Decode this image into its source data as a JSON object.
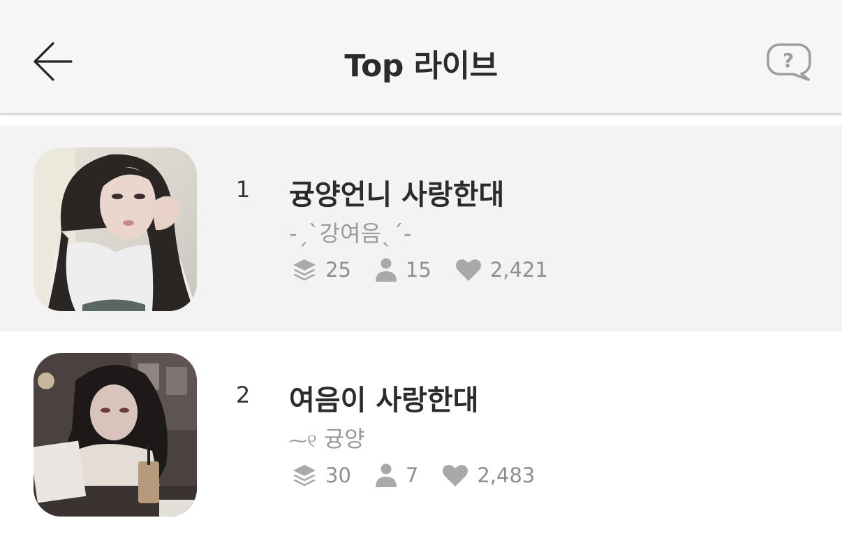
{
  "header": {
    "title": "Top 라이브",
    "back_icon": "arrow-left-icon",
    "help_icon": "question-bubble-icon"
  },
  "lives": [
    {
      "rank": "1",
      "title": "귱양언니 사랑한대",
      "host": "-ˏˋ강여음ˎˊ-",
      "episodes": "25",
      "viewers": "15",
      "likes": "2,421",
      "highlighted": true
    },
    {
      "rank": "2",
      "title": "여음이 사랑한대",
      "host": "귱양",
      "host_flourish": "⁓୧",
      "episodes": "30",
      "viewers": "7",
      "likes": "2,483",
      "highlighted": false
    }
  ],
  "colors": {
    "header_bg": "#f6f6f6",
    "highlight_row": "#f3f3f3",
    "title_text": "#2b2b2b",
    "meta_text": "#8e8e8e",
    "icon_gray": "#a9a9a9"
  }
}
